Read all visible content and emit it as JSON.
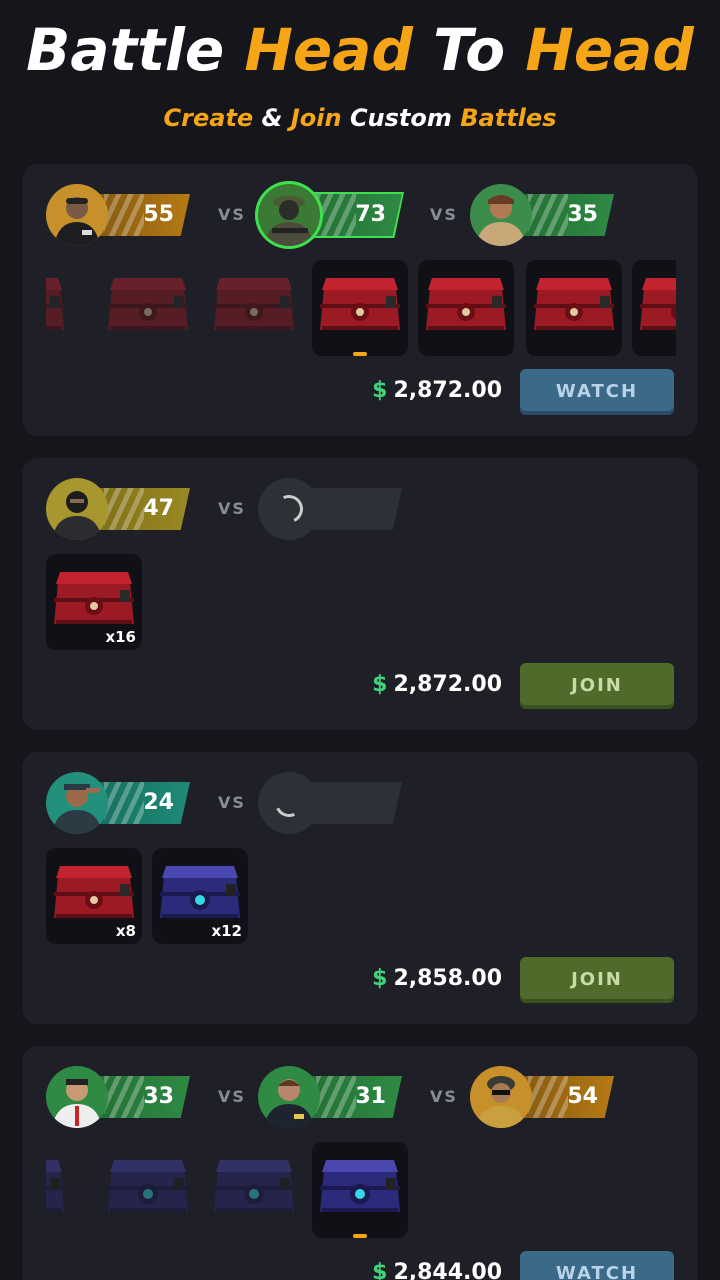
{
  "header": {
    "title_parts": [
      "Battle",
      "Head",
      "To",
      "Head"
    ],
    "subtitle_parts": [
      "Create",
      "&",
      "Join",
      "Custom",
      "Battles"
    ]
  },
  "colors": {
    "accent": "#f5a516",
    "money": "#3ed477",
    "watch_button": "#3b6988",
    "join_button": "#4f6b2c",
    "level_gold": "#b67a14",
    "level_green": "#2f8a44",
    "level_olive": "#9a8a24",
    "level_teal": "#1f8a77"
  },
  "vs_label": "VS",
  "battles": [
    {
      "players": [
        {
          "level": "55",
          "avatar": "fbi-agent-avatar",
          "color": "gold"
        },
        {
          "level": "73",
          "avatar": "soldier-avatar",
          "color": "green",
          "highlight": true
        },
        {
          "level": "35",
          "avatar": "terrorist-avatar",
          "color": "green"
        }
      ],
      "price_currency": "$",
      "price": "2,872.00",
      "button": "WATCH"
    },
    {
      "players": [
        {
          "level": "47",
          "avatar": "balaclava-avatar",
          "color": "olive"
        }
      ],
      "cases": [
        {
          "qty": "x16",
          "type": "red-case"
        }
      ],
      "price_currency": "$",
      "price": "2,872.00",
      "button": "JOIN"
    },
    {
      "players": [
        {
          "level": "24",
          "avatar": "saluting-soldier-avatar",
          "color": "teal"
        }
      ],
      "cases": [
        {
          "qty": "x8",
          "type": "red-case"
        },
        {
          "qty": "x12",
          "type": "blue-case"
        }
      ],
      "price_currency": "$",
      "price": "2,858.00",
      "button": "JOIN"
    },
    {
      "players": [
        {
          "level": "33",
          "avatar": "white-jacket-avatar",
          "color": "green"
        },
        {
          "level": "31",
          "avatar": "fbi-agent-avatar",
          "color": "green"
        },
        {
          "level": "54",
          "avatar": "helmet-soldier-avatar",
          "color": "gold"
        }
      ],
      "price_currency": "$",
      "price": "2,844.00",
      "button": "WATCH"
    }
  ]
}
